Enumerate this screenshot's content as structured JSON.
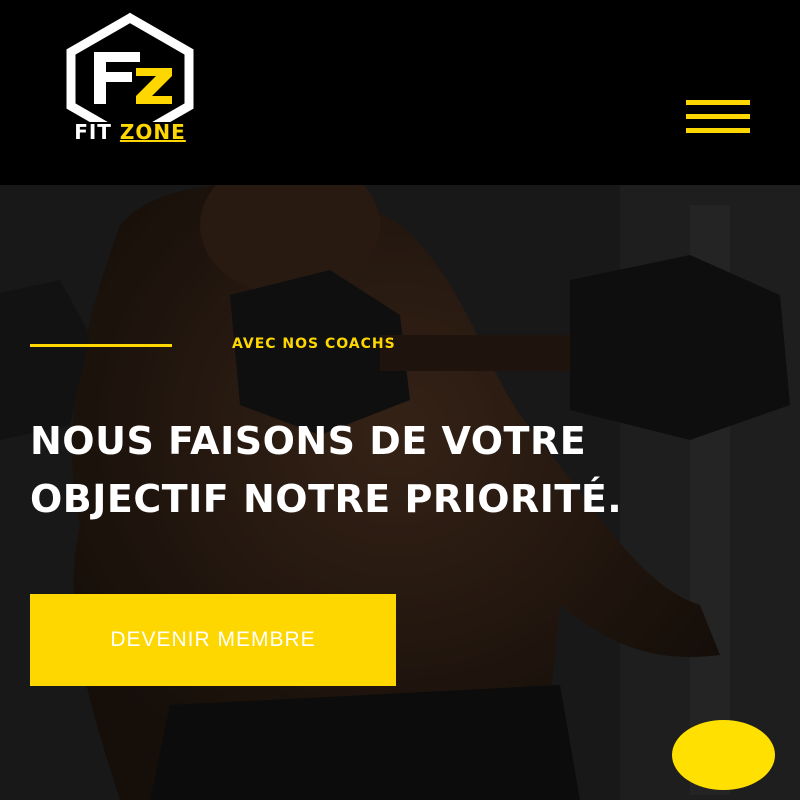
{
  "header": {
    "logo": {
      "fit": "FIT",
      "zone": "ZONE",
      "mark": "FZ"
    },
    "menu": {
      "icon": "hamburger-icon"
    }
  },
  "hero": {
    "eyebrow": "AVEC NOS COACHS",
    "headline_line1": "NOUS FAISONS DE VOTRE",
    "headline_line2": "OBJECTIF NOTRE PRIORITÉ.",
    "cta": "DEVENIR MEMBRE"
  },
  "chat": {
    "icon": "chat-bubble-icon"
  },
  "colors": {
    "accent": "#FFD700",
    "background": "#000000",
    "text": "#FFFFFF"
  }
}
